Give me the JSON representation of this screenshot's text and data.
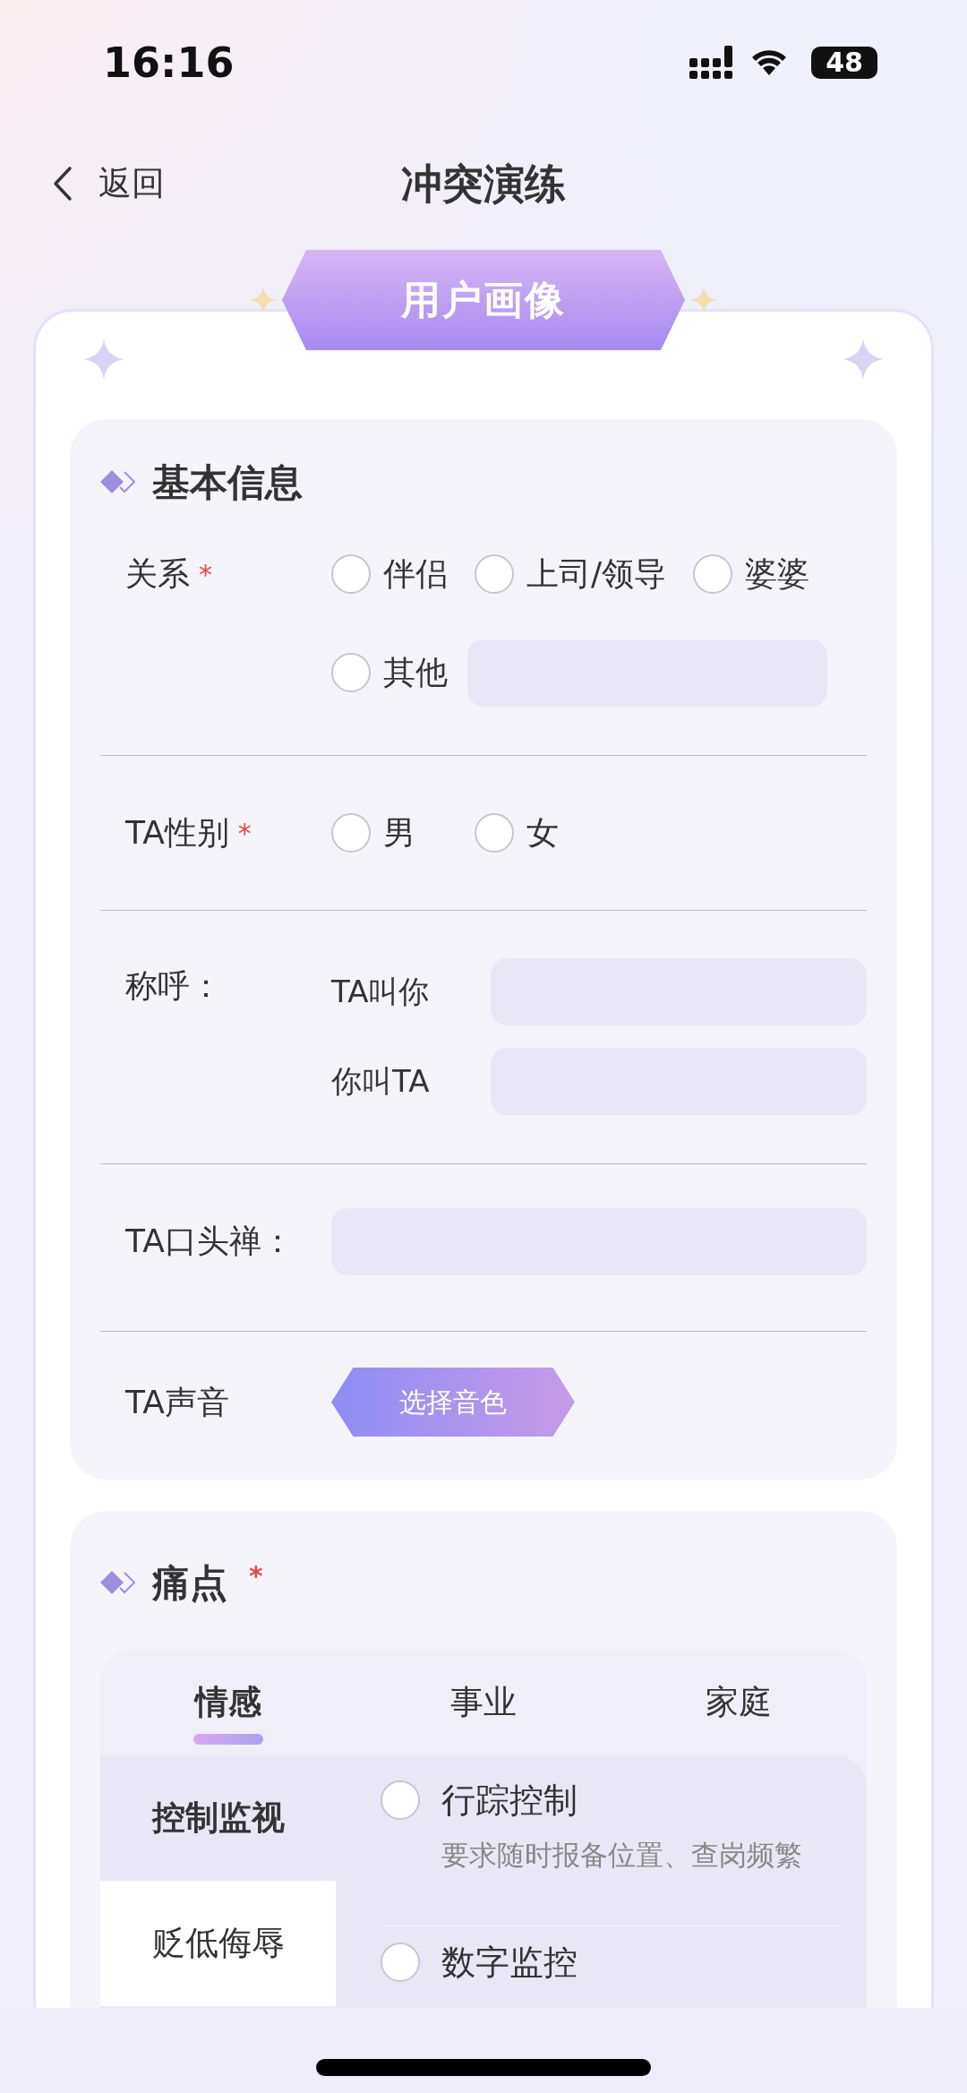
{
  "status_bar": {
    "time": "16:16",
    "battery": "48"
  },
  "nav": {
    "back": "返回",
    "title": "冲突演练"
  },
  "banner": "用户画像",
  "basic_info": {
    "title": "基本信息",
    "relation": {
      "label": "关系",
      "required_mark": "*",
      "options": [
        {
          "kind": "radio",
          "label": "伴侣",
          "selected": false
        },
        {
          "kind": "radio",
          "label": "上司/领导",
          "selected": false
        },
        {
          "kind": "radio",
          "label": "婆婆",
          "selected": false
        },
        {
          "kind": "radio-with-input",
          "label": "其他",
          "selected": false
        }
      ]
    },
    "gender": {
      "label": "TA性别",
      "required_mark": "*",
      "options": [
        {
          "kind": "radio",
          "label": "男",
          "selected": false
        },
        {
          "kind": "radio",
          "label": "女",
          "selected": false
        }
      ]
    },
    "address": {
      "label": "称呼：",
      "fields": [
        {
          "label": "TA叫你"
        },
        {
          "label": "你叫TA"
        }
      ]
    },
    "catchphrase": {
      "label": "TA口头禅："
    },
    "voice": {
      "label": "TA声音",
      "button": "选择音色"
    }
  },
  "pain_points": {
    "title": "痛点",
    "required_mark": "*",
    "tabs": [
      {
        "label": "情感",
        "selected": true
      },
      {
        "label": "事业",
        "selected": false
      },
      {
        "label": "家庭",
        "selected": false
      }
    ],
    "categories": [
      {
        "label": "控制监视",
        "selected": true
      },
      {
        "label": "贬低侮辱",
        "selected": false
      }
    ],
    "options": [
      {
        "title": "行踪控制",
        "description": "要求随时报备位置、查岗频繁",
        "selected": false
      },
      {
        "title": "数字监控",
        "selected": false
      }
    ]
  }
}
